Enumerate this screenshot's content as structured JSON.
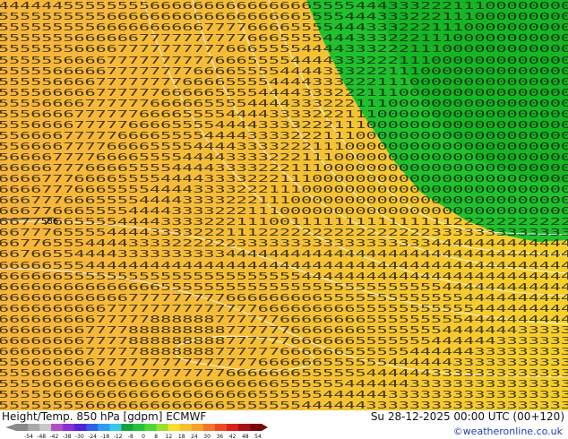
{
  "map": {
    "field_colors": {
      "warm": "#f5b93a",
      "mid": "#f4c132",
      "yellow": "#f5d02a",
      "green": "#1fc12c",
      "green_dark": "#12a81f",
      "contour": "#ffffff",
      "label": "#111111"
    },
    "label_rows": [
      "44444455555555666666666666666555544433322211100000000",
      "55555555556666666666666666665555444333222111000000000",
      "55555555566666666667777666655554443332221110000000000",
      "55555556666667777777777666555544433322211100000000000",
      "55555556666777777777766655554444333222111000000000000",
      "55555566667777777777666555544443332221110000000000000",
      "55555666667777777766665555444433322211100000000000000",
      "55555666677777777666655554444333222111000000000000000",
      "55556666677777766666555544443332221110000000000000000",
      "55556666777777666665555444433322211100000000000000000",
      "55566667777776666555544443333222111000000000000000000",
      "55566667777766665555444433332221110000000000000000000",
      "55666677777666655554444333322211100000000000000000000",
      "55666677776666555544443333222111000000000000000000000",
      "56666777766665555444433332221110000000000000000000000",
      "66666777666655554444333322211100000000000000000000000",
      "66667776666555544443333222111000000000000000000000000",
      "66667776665555444433332221110000000000000000000000000",
      "66677766655554444333322211100000000000000000000000000",
      "66677666555544443333222111000000000000000000000000000",
      "66777665555444433332221110011111111111111122222222222",
      "66777655554444333322211122222222222222223333333333333",
      "66776555444433332222223333333333333333334444444444444",
      "66766554444333333333344444444444444444444444444444444",
      "66666555444444444444444444444444444444444444444444444",
      "66666655555555555555555555554444444444444444444444444",
      "66666666666666655555555555555555555555555444444444444",
      "66666666666677777777766666666655555555555554444444444",
      "66666666667777777777777766666666655555555555444444444",
      "66666666677777888888777777666666665555555554444444444",
      "66666666777788888888877777766666665555555444444433333",
      "66666666777788888888877777766666655555554444443333333",
      "66666666777778888888777777666666555555444444333333333",
      "55666666677777777777777766666655555544444433333333333",
      "55566666666777777777766666665555554444443333333333333",
      "55556666666666666666666666555555444444333333333333333",
      "55555666666666666666666655555544444433333333333333333",
      "55555555666666666666655555554444443333333333333333333"
    ],
    "marker_label": "586"
  },
  "footer": {
    "title": "Height/Temp. 850 hPa [gdpm] ECMWF",
    "run_info": "Su 28-12-2025 00:00 UTC (00+120)",
    "credit": "©weatheronline.co.uk",
    "colorbar": {
      "colors": [
        "#8a8a8a",
        "#a8a8a8",
        "#c8c8c8",
        "#b04dc9",
        "#8d2bd8",
        "#4f26d9",
        "#2f5fe5",
        "#2c9cef",
        "#36c9ee",
        "#16a33a",
        "#23c23a",
        "#4dd83a",
        "#9ae02d",
        "#f5e12a",
        "#f5c22d",
        "#f5a028",
        "#f2762a",
        "#ee4a22",
        "#d9221b",
        "#a51313",
        "#7a0a0a"
      ],
      "ticks": [
        "-54",
        "-48",
        "-42",
        "-38",
        "-30",
        "-24",
        "-18",
        "-12",
        "-8",
        "0",
        "8",
        "12",
        "18",
        "24",
        "30",
        "36",
        "42",
        "48",
        "54"
      ]
    }
  }
}
